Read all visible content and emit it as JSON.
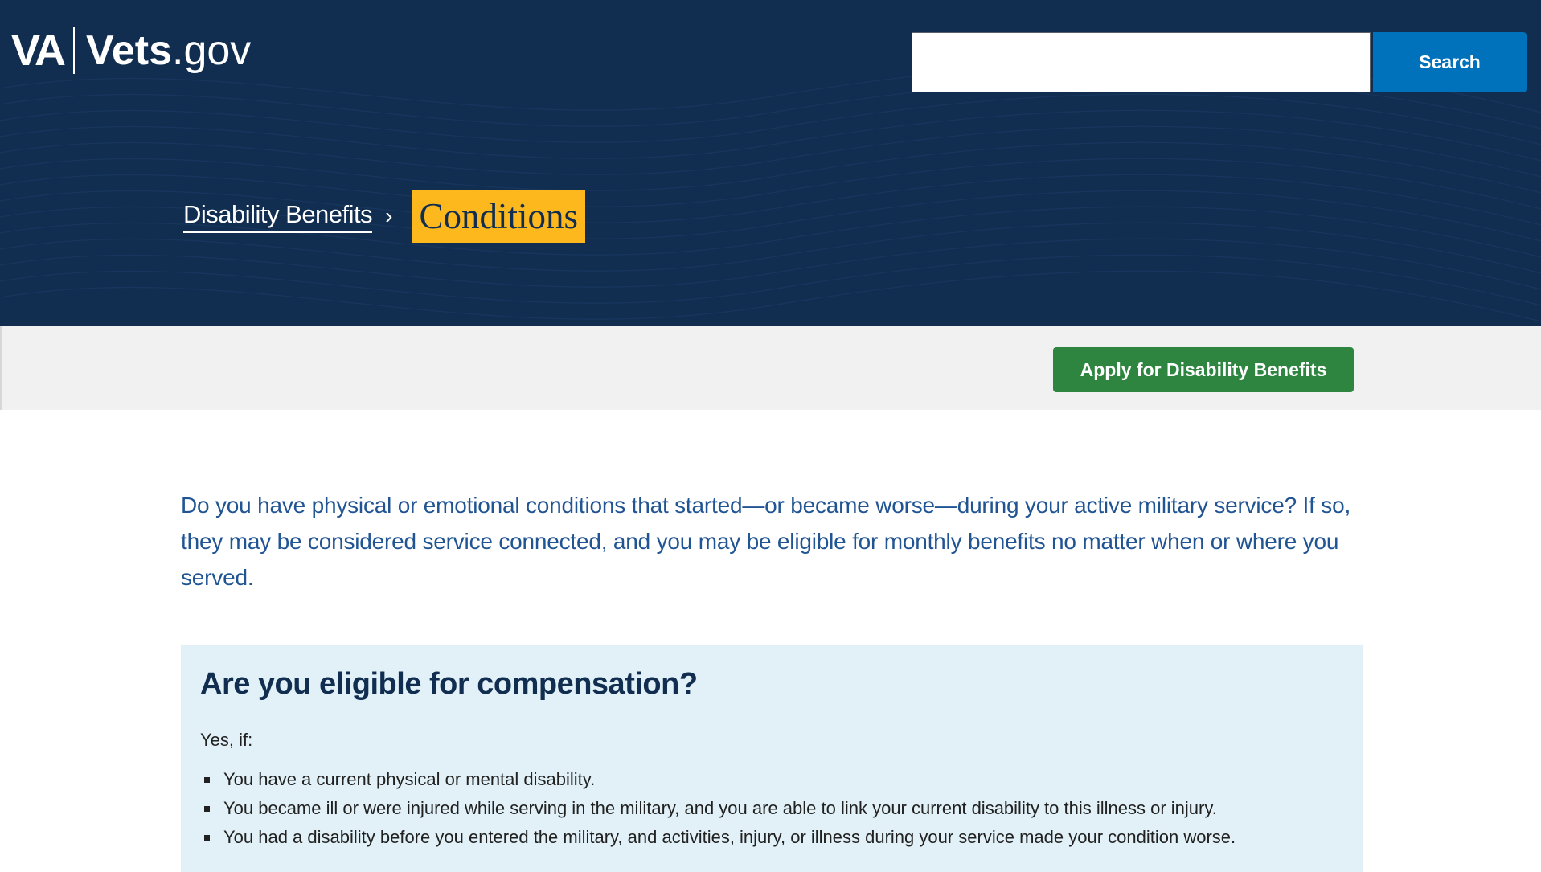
{
  "header": {
    "logo": {
      "va": "VA",
      "vets": "Vets",
      "dot": ".",
      "gov": "gov"
    },
    "search": {
      "placeholder": "",
      "value": "",
      "button_label": "Search"
    }
  },
  "breadcrumb": {
    "parent_label": "Disability Benefits",
    "separator": "›",
    "current_label": "Conditions"
  },
  "action_bar": {
    "apply_label": "Apply for Disability Benefits"
  },
  "main": {
    "intro": "Do you have physical or emotional conditions that started—or became worse—during your active military service? If so, they may be considered service connected, and you may be eligible for monthly benefits no matter when or where you served.",
    "eligibility": {
      "title": "Are you eligible for compensation?",
      "lead": "Yes, if:",
      "items": [
        "You have a current physical or mental disability.",
        "You became ill or were injured while serving in the military, and you are able to link your current disability to this illness or injury.",
        "You had a disability before you entered the military, and activities, injury, or illness during your service made your condition worse."
      ]
    }
  },
  "colors": {
    "header_bg": "#112e51",
    "search_button": "#0071bb",
    "current_crumb_bg": "#fdb81e",
    "apply_button": "#2e8540",
    "intro_text": "#205493",
    "eligibility_bg": "#e1f1f7"
  }
}
